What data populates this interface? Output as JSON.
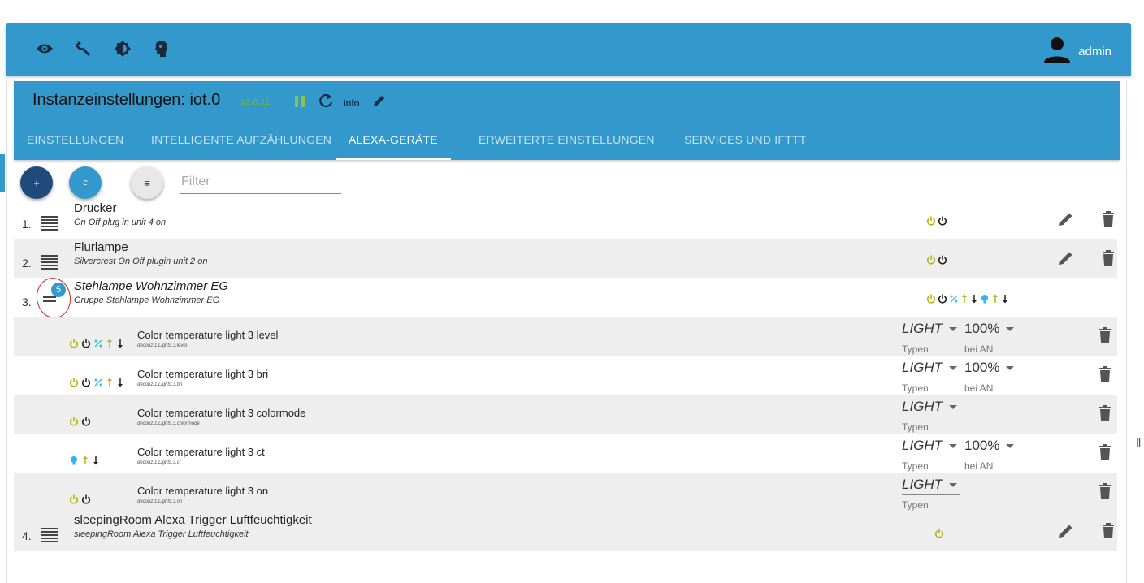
{
  "header": {
    "icons": [
      "eye-icon",
      "wrench-icon",
      "brightness-icon",
      "head-icon"
    ],
    "user_label": "admin"
  },
  "instance": {
    "title": "Instanzeinstellungen: iot.0",
    "version": "v2.0.11",
    "info_label": "info"
  },
  "tabs": [
    {
      "label": "EINSTELLUNGEN"
    },
    {
      "label": "INTELLIGENTE AUFZÄHLUNGEN"
    },
    {
      "label": "ALEXA-GERÄTE",
      "active": true
    },
    {
      "label": "ERWEITERTE EINSTELLUNGEN"
    },
    {
      "label": "SERVICES UND IFTTT"
    }
  ],
  "toolbar": {
    "add_label": "+",
    "refresh_label": "c",
    "list_label": "≡",
    "filter_placeholder": "Filter"
  },
  "colors": {
    "brand": "#3399cc",
    "power_on": "#b5b512",
    "power_off": "#222222",
    "percent": "#33c6d9",
    "bulb": "#29b6f6"
  },
  "devices": [
    {
      "num": "1.",
      "name": "Drucker",
      "description": "On Off plug in unit 4 on",
      "caps": [
        "power-on",
        "power-off"
      ]
    },
    {
      "num": "2.",
      "name": "Flurlampe",
      "description": "Silvercrest On Off plugin unit 2 on",
      "caps": [
        "power-on",
        "power-off"
      ]
    },
    {
      "num": "3.",
      "name": "Stehlampe Wohnzimmer EG",
      "description": "Gruppe Stehlampe Wohnzimmer EG",
      "badge": "5",
      "caps": [
        "power-on",
        "power-off",
        "percent",
        "arrow-up",
        "arrow-down",
        "bulb",
        "arrow-up",
        "arrow-down"
      ],
      "children": [
        {
          "name": "Color temperature light 3 level",
          "id": "deconz.1.Lights.3.level",
          "caps": [
            "power-on",
            "power-off",
            "percent",
            "arrow-up",
            "arrow-down"
          ],
          "type": "LIGHT",
          "type_help": "Typen",
          "on_value": "100%",
          "on_help": "bei AN"
        },
        {
          "name": "Color temperature light 3 bri",
          "id": "deconz.1.Lights.3.bri",
          "caps": [
            "power-on",
            "power-off",
            "percent",
            "arrow-up",
            "arrow-down"
          ],
          "type": "LIGHT",
          "type_help": "Typen",
          "on_value": "100%",
          "on_help": "bei AN"
        },
        {
          "name": "Color temperature light 3 colormode",
          "id": "deconz.1.Lights.3.colormode",
          "caps": [
            "power-on",
            "power-off"
          ],
          "type": "LIGHT",
          "type_help": "Typen"
        },
        {
          "name": "Color temperature light 3 ct",
          "id": "deconz.1.Lights.3.ct",
          "caps": [
            "bulb",
            "arrow-up",
            "arrow-down"
          ],
          "type": "LIGHT",
          "type_help": "Typen",
          "on_value": "100%",
          "on_help": "bei AN"
        },
        {
          "name": "Color temperature light 3 on",
          "id": "deconz.1.Lights.3.on",
          "caps": [
            "power-on",
            "power-off"
          ],
          "type": "LIGHT",
          "type_help": "Typen"
        }
      ]
    },
    {
      "num": "4.",
      "name": "sleepingRoom Alexa Trigger Luftfeuchtigkeit",
      "description": "sleepingRoom Alexa Trigger Luftfeuchtigkeit",
      "caps": [
        "power-on"
      ]
    }
  ]
}
